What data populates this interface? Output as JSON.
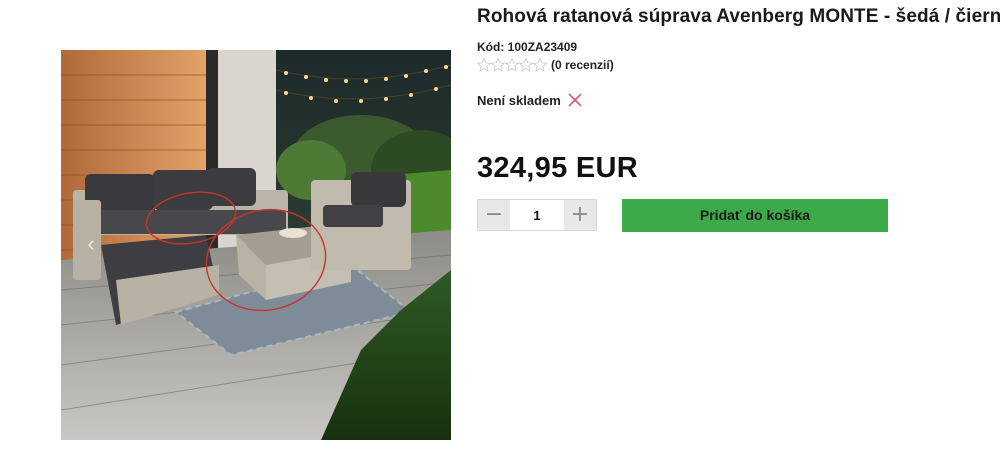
{
  "product": {
    "title": "Rohová ratanová súprava Avenberg MONTE - šedá / čierna",
    "code_label": "Kód:",
    "code_value": "100ZA23409",
    "rating": {
      "stars_filled": 0,
      "stars_total": 5,
      "review_count_text": "(0 recenzií)"
    },
    "stock": {
      "text": "Není skladem",
      "icon": "cross-icon",
      "icon_color": "#e05a6a"
    },
    "price": "324,95 EUR"
  },
  "cart": {
    "quantity": "1",
    "minus_label": "−",
    "plus_label": "+",
    "add_button_label": "Pridať do košíka",
    "button_color": "#3daa4a"
  },
  "gallery": {
    "image": "product-photo-rattan-garden-set",
    "prev_arrow": "chevron-left-icon"
  }
}
